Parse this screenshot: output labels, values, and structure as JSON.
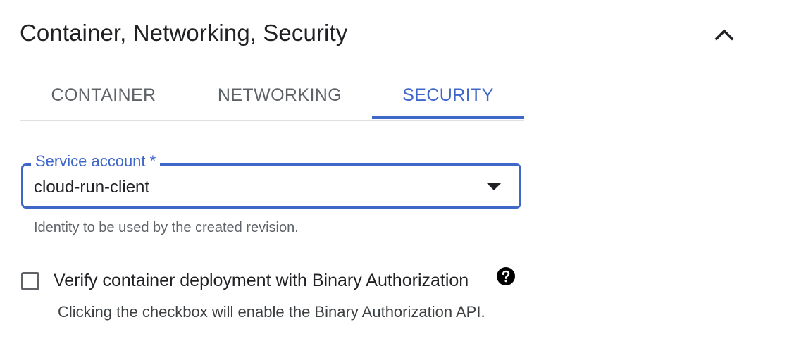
{
  "section": {
    "title": "Container, Networking, Security",
    "collapse_icon": "chevron-up-icon"
  },
  "tabs": [
    {
      "label": "CONTAINER",
      "active": false
    },
    {
      "label": "NETWORKING",
      "active": false
    },
    {
      "label": "SECURITY",
      "active": true
    }
  ],
  "colors": {
    "accent": "#3f67c9",
    "text_primary": "#202124",
    "text_secondary": "#5f6368",
    "divider": "#e0e0e0"
  },
  "service_account": {
    "label": "Service account *",
    "value": "cloud-run-client",
    "helper": "Identity to be used by the created revision.",
    "dropdown_icon": "dropdown-arrow-icon"
  },
  "binary_authorization": {
    "checked": false,
    "label": "Verify container deployment with Binary Authorization",
    "helper": "Clicking the checkbox will enable the Binary Authorization API.",
    "help_icon": "help-icon"
  }
}
